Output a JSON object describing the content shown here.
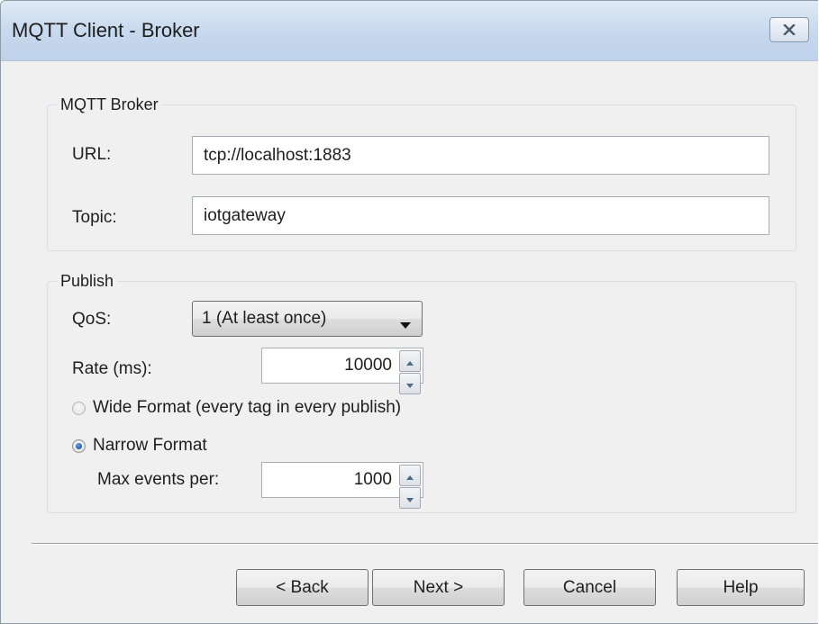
{
  "window": {
    "title": "MQTT Client - Broker"
  },
  "broker": {
    "legend": "MQTT Broker",
    "url_label": "URL:",
    "url_value": "tcp://localhost:1883",
    "topic_label": "Topic:",
    "topic_value": "iotgateway"
  },
  "publish": {
    "legend": "Publish",
    "qos_label": "QoS:",
    "qos_selected": "1 (At least once)",
    "rate_label": "Rate (ms):",
    "rate_value": "10000",
    "wide_label": "Wide Format (every tag in every publish)",
    "wide_checked": false,
    "narrow_label": "Narrow Format",
    "narrow_checked": true,
    "max_events_label": "Max events per:",
    "max_events_value": "1000"
  },
  "buttons": {
    "back": "< Back",
    "next": "Next >",
    "cancel": "Cancel",
    "help": "Help"
  },
  "icons": {
    "close": "close-icon",
    "dropdown": "chevron-down-icon",
    "spin_up": "spin-up-icon",
    "spin_down": "spin-down-icon"
  }
}
